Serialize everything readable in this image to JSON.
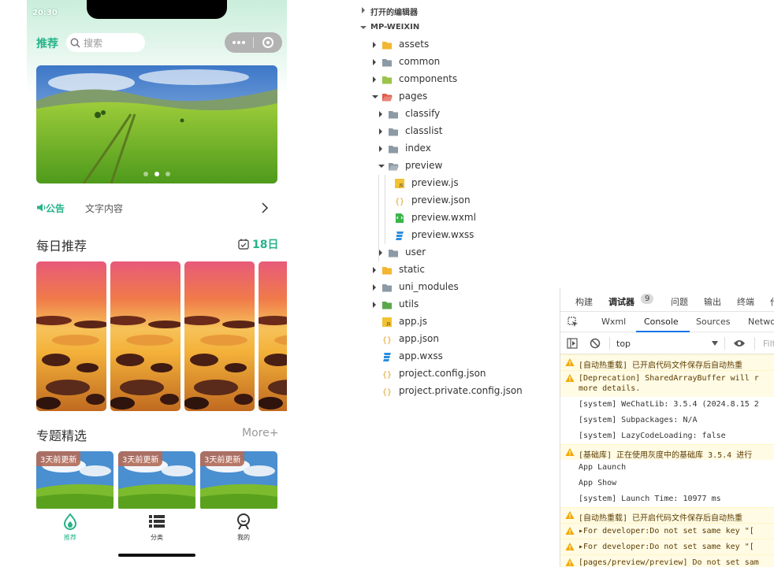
{
  "phone": {
    "status_time": "20:30",
    "nav_title": "推荐",
    "search_placeholder": "搜索",
    "notice_label": "公告",
    "notice_text": "文字内容",
    "daily_title": "每日推荐",
    "daily_date": "18日",
    "topic_title": "专题精选",
    "topic_more": "More+",
    "topic_tags": [
      "3天前更新",
      "3天前更新",
      "3天前更新"
    ],
    "tabs": [
      {
        "label": "推荐",
        "icon": "leaf-flame-icon",
        "active": true
      },
      {
        "label": "分类",
        "icon": "list-icon",
        "active": false
      },
      {
        "label": "我的",
        "icon": "person-icon",
        "active": false
      }
    ],
    "accent": "#28b389"
  },
  "explorer": {
    "open_editors": "打开的编辑器",
    "project": "MP-WEIXIN",
    "tree": [
      {
        "name": "assets",
        "type": "folder",
        "color": "#f2b632"
      },
      {
        "name": "common",
        "type": "folder",
        "color": "#8c9aa6"
      },
      {
        "name": "components",
        "type": "folder",
        "color": "#9bc34a"
      },
      {
        "name": "pages",
        "type": "folder-open",
        "color": "#e25b4b"
      },
      {
        "name": "classify",
        "type": "folder",
        "color": "#8c9aa6"
      },
      {
        "name": "classlist",
        "type": "folder",
        "color": "#8c9aa6"
      },
      {
        "name": "index",
        "type": "folder",
        "color": "#8c9aa6"
      },
      {
        "name": "preview",
        "type": "folder-open",
        "color": "#8c9aa6"
      },
      {
        "name": "preview.js",
        "type": "js",
        "color": "#f2c232"
      },
      {
        "name": "preview.json",
        "type": "json",
        "color": "#e0a020"
      },
      {
        "name": "preview.wxml",
        "type": "wxml",
        "color": "#3bb44a"
      },
      {
        "name": "preview.wxss",
        "type": "wxss",
        "color": "#2a8de0"
      },
      {
        "name": "user",
        "type": "folder",
        "color": "#8c9aa6"
      },
      {
        "name": "static",
        "type": "folder",
        "color": "#f2b632"
      },
      {
        "name": "uni_modules",
        "type": "folder",
        "color": "#8c9aa6"
      },
      {
        "name": "utils",
        "type": "folder",
        "color": "#5aa84a"
      },
      {
        "name": "app.js",
        "type": "js",
        "color": "#f2c232"
      },
      {
        "name": "app.json",
        "type": "json",
        "color": "#e0a020"
      },
      {
        "name": "app.wxss",
        "type": "wxss",
        "color": "#2a8de0"
      },
      {
        "name": "project.config.json",
        "type": "json",
        "color": "#e0a020"
      },
      {
        "name": "project.private.config.json",
        "type": "json",
        "color": "#e0a020"
      }
    ]
  },
  "devtools": {
    "top_tabs": [
      "构建",
      "调试器",
      "9",
      "问题",
      "输出",
      "终端",
      "代"
    ],
    "panel_tabs": [
      "Wxml",
      "Console",
      "Sources",
      "Netwo"
    ],
    "context": "top",
    "filter_placeholder": "Filt",
    "logs": [
      {
        "level": "warn",
        "text": "[自动热重载] 已开启代码文件保存后自动热重",
        "text2": ""
      },
      {
        "level": "warn",
        "text": "[Deprecation] SharedArrayBuffer will r",
        "text2": "more details."
      },
      {
        "level": "info",
        "text": "[system] WeChatLib: 3.5.4 (2024.8.15 2",
        "text2": ""
      },
      {
        "level": "info",
        "text": "[system] Subpackages: N/A",
        "text2": ""
      },
      {
        "level": "info",
        "text": "[system] LazyCodeLoading: false",
        "text2": ""
      },
      {
        "level": "warn",
        "text": "[基础库] 正在使用灰度中的基础库 3.5.4 进行",
        "text2": ""
      },
      {
        "level": "info",
        "text": "App Launch",
        "text2": ""
      },
      {
        "level": "info",
        "text": "App Show",
        "text2": ""
      },
      {
        "level": "info",
        "text": "[system] Launch Time: 10977 ms",
        "text2": ""
      },
      {
        "level": "warn",
        "text": "[自动热重载] 已开启代码文件保存后自动热重",
        "text2": ""
      },
      {
        "level": "warn",
        "text": "▸For developer:Do not set same key \"[",
        "text2": ""
      },
      {
        "level": "warn",
        "text": "▸For developer:Do not set same key \"[",
        "text2": ""
      },
      {
        "level": "warn",
        "text": "[pages/preview/preview] Do not set sam",
        "text2": ""
      }
    ]
  }
}
